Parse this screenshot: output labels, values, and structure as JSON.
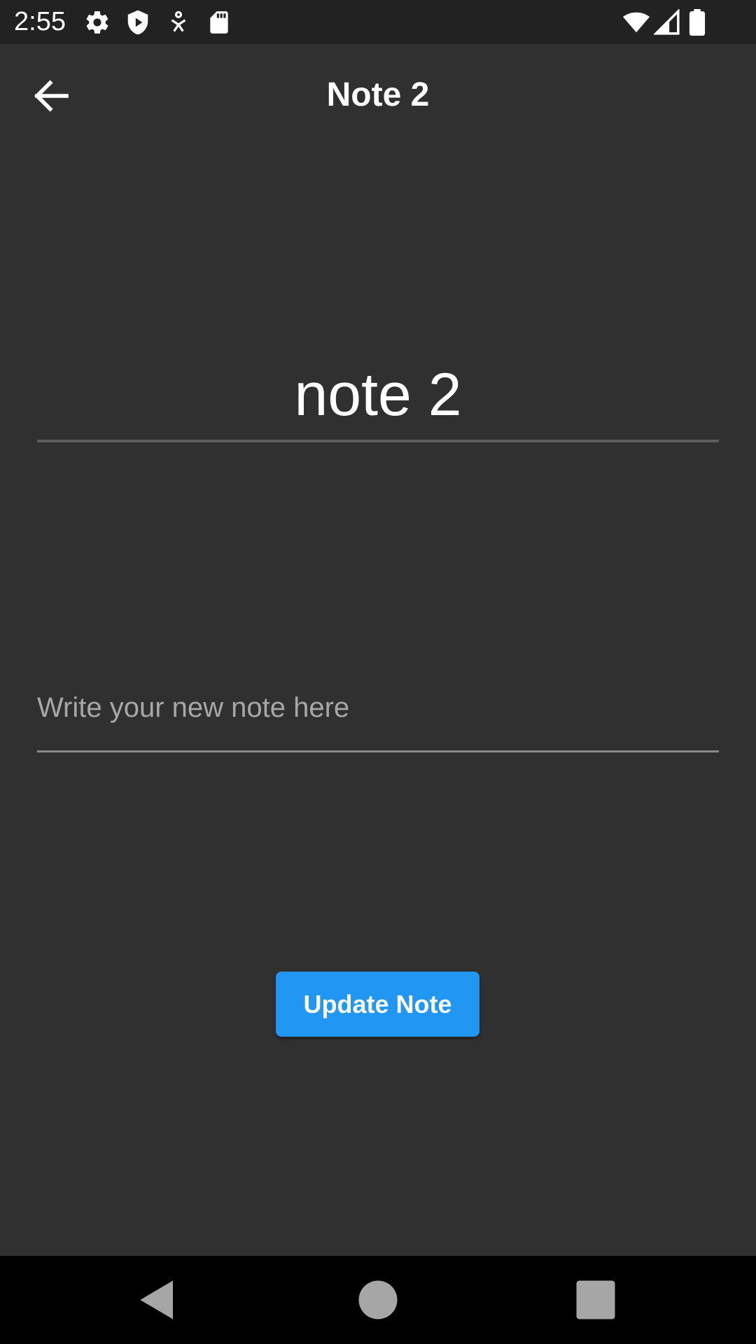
{
  "status_bar": {
    "time": "2:55",
    "icons": [
      "settings-icon",
      "shield-play-icon",
      "accessibility-icon",
      "sd-card-icon",
      "wifi-icon",
      "signal-icon",
      "battery-icon"
    ]
  },
  "app_bar": {
    "back_icon": "arrow-back-icon",
    "title": "Note 2"
  },
  "form": {
    "title_value": "note 2",
    "note_value": "",
    "note_placeholder": "Write your new note here"
  },
  "actions": {
    "update_label": "Update Note"
  },
  "nav_bar": {
    "icons": [
      "back-triangle-icon",
      "home-circle-icon",
      "recents-square-icon"
    ]
  },
  "colors": {
    "background": "#303030",
    "status_bar": "#222222",
    "accent": "#2196f3",
    "nav_bar": "#000000"
  }
}
